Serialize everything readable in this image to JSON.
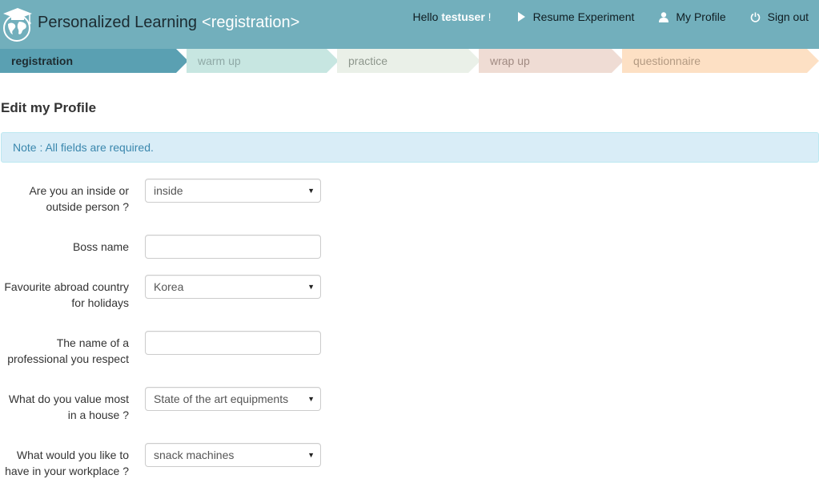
{
  "header": {
    "app_title": "Personalized Learning",
    "app_subtitle": "<registration>",
    "hello_prefix": "Hello ",
    "username": "testuser",
    "hello_suffix": " !",
    "nav": {
      "resume": "Resume Experiment",
      "profile": "My Profile",
      "signout": "Sign out"
    },
    "icons": {
      "logo": "graduation-globe-logo",
      "resume": "play-icon",
      "profile": "user-icon",
      "signout": "power-icon"
    }
  },
  "steps": [
    {
      "label": "registration",
      "state": "active"
    },
    {
      "label": "warm up",
      "state": "pending"
    },
    {
      "label": "practice",
      "state": "pending"
    },
    {
      "label": "wrap up",
      "state": "pending"
    },
    {
      "label": "questionnaire",
      "state": "pending"
    }
  ],
  "main": {
    "title": "Edit my Profile",
    "note": "Note : All fields are required."
  },
  "form": {
    "fields": [
      {
        "label_1": "Are you an inside or",
        "label_2": "outside person ?",
        "type": "select",
        "value": "inside"
      },
      {
        "label_1": "Boss name",
        "type": "text",
        "value": ""
      },
      {
        "label_1": "Favourite abroad country",
        "label_2": "for holidays",
        "type": "select",
        "value": "Korea"
      },
      {
        "label_1": "The name of a",
        "label_2": "professional you respect",
        "type": "text",
        "value": ""
      },
      {
        "label_1": "What do you value most",
        "label_2": "in a house ?",
        "type": "select",
        "value": "State of the art equipments"
      },
      {
        "label_1": "What would you like to",
        "label_2": "have in your workplace ?",
        "type": "select",
        "value": "snack machines"
      }
    ]
  },
  "colors": {
    "header_bg": "#72afbc",
    "step_active": "#5aa0b2",
    "step_warmup": "#c7e6e1",
    "step_practice": "#eaf0e8",
    "step_wrapup": "#efdcd4",
    "step_questionnaire": "#fde0c4",
    "note_bg": "#d9edf7",
    "note_text": "#3a87ad"
  }
}
